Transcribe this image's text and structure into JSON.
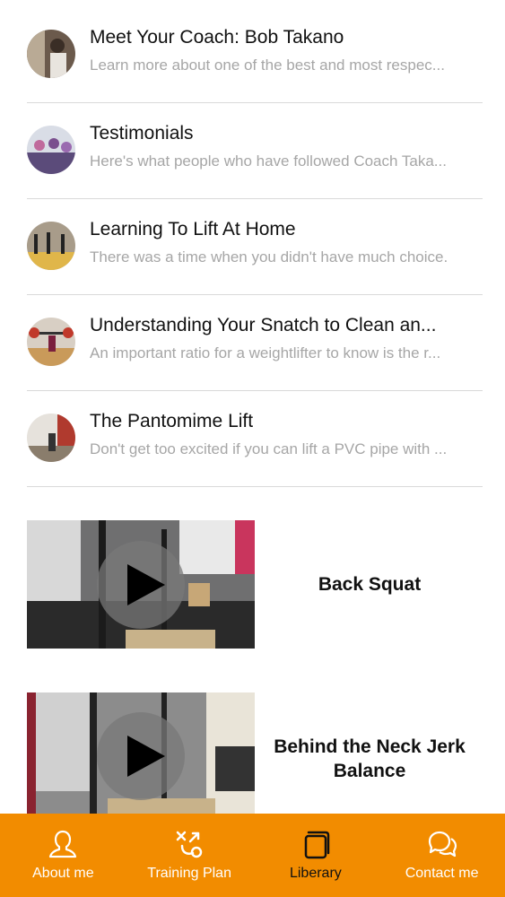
{
  "articles": [
    {
      "title": "Meet Your Coach: Bob Takano",
      "subtitle": "Learn more about one of the best and most respec..."
    },
    {
      "title": "Testimonials",
      "subtitle": "Here's what people who have followed Coach Taka..."
    },
    {
      "title": "Learning To Lift At Home",
      "subtitle": "There was a time when you didn't have much choice."
    },
    {
      "title": "Understanding Your Snatch to Clean an...",
      "subtitle": "An important ratio for a weightlifter to know is the r..."
    },
    {
      "title": "The Pantomime Lift",
      "subtitle": "Don't get too excited if you can lift a PVC pipe with ..."
    }
  ],
  "videos": [
    {
      "title": "Back Squat"
    },
    {
      "title": "Behind the Neck Jerk Balance"
    }
  ],
  "tabbar": {
    "tabs": [
      {
        "label": "About me",
        "icon": "person-icon",
        "active": false
      },
      {
        "label": "Training Plan",
        "icon": "training-plan-icon",
        "active": false
      },
      {
        "label": "Liberary",
        "icon": "library-icon",
        "active": true
      },
      {
        "label": "Contact me",
        "icon": "chat-icon",
        "active": false
      }
    ]
  },
  "colors": {
    "accent": "#f28c00",
    "active_tab_text": "#111111",
    "subtitle": "#a6a6a6"
  }
}
